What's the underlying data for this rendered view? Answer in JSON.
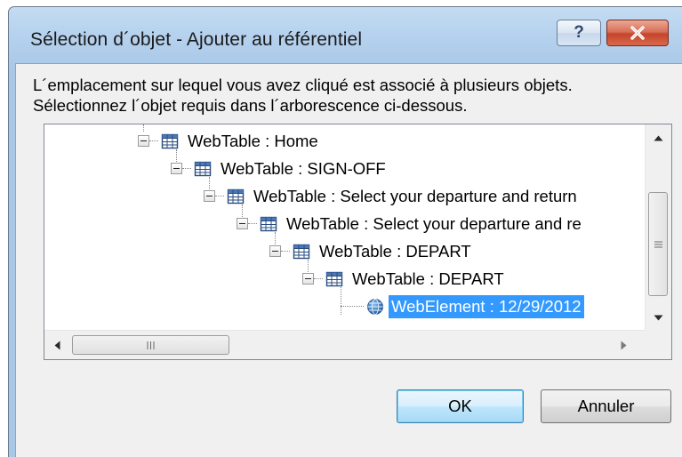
{
  "dialog": {
    "title": "Sélection d´objet - Ajouter au référentiel",
    "help_label": "?",
    "message_line1": "L´emplacement sur lequel vous avez cliqué est associé à plusieurs objets.",
    "message_line2": "Sélectionnez l´objet requis dans l´arborescence ci-dessous."
  },
  "tree": {
    "nodes": [
      {
        "label": "WebTable : Home",
        "icon": "table-icon",
        "expanded": true
      },
      {
        "label": "WebTable : SIGN-OFF",
        "icon": "table-icon",
        "expanded": true
      },
      {
        "label": "WebTable : Select your departure and return",
        "icon": "table-icon",
        "expanded": true
      },
      {
        "label": "WebTable : Select your departure and re",
        "icon": "table-icon",
        "expanded": true
      },
      {
        "label": "WebTable : DEPART",
        "icon": "table-icon",
        "expanded": true
      },
      {
        "label": "WebTable : DEPART",
        "icon": "table-icon",
        "expanded": true
      },
      {
        "label": "WebElement : 12/29/2012",
        "icon": "globe-icon",
        "selected": true
      }
    ]
  },
  "buttons": {
    "ok_label": "OK",
    "cancel_label": "Annuler"
  },
  "colors": {
    "selection": "#3399ff",
    "close_button": "#c4452c",
    "title_bar": "#b6d2ee"
  }
}
